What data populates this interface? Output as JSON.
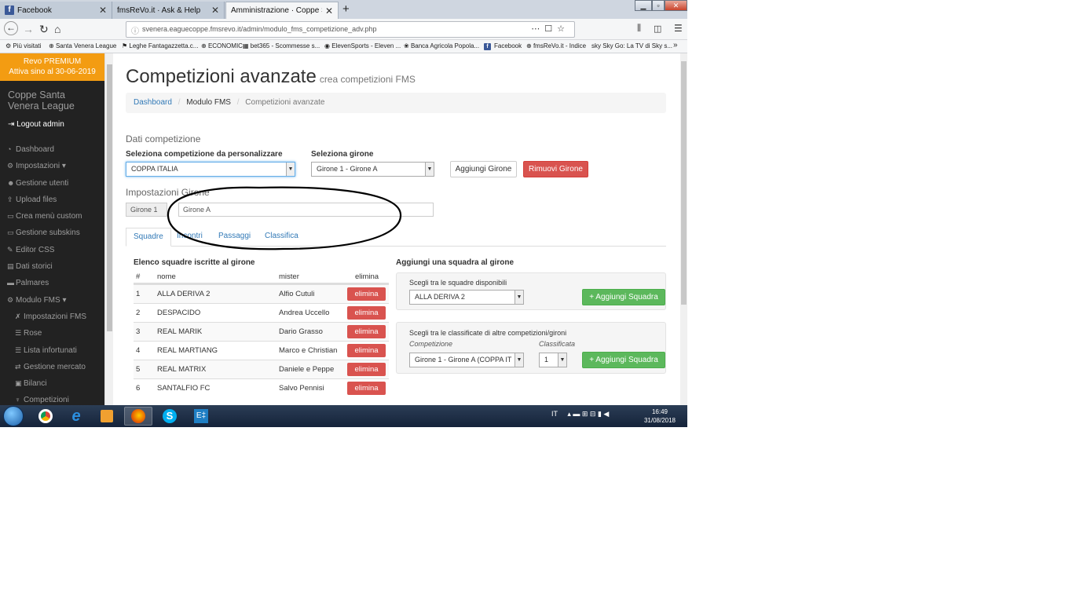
{
  "browser": {
    "tabs": [
      {
        "label": "Facebook",
        "active": false
      },
      {
        "label": "fmsReVo.it · Ask & Help",
        "active": false
      },
      {
        "label": "Amministrazione · Coppe Santa Ve",
        "active": true
      }
    ],
    "new_tab": "+",
    "url": "svenera.eaguecoppe.fmsrevo.it/admin/modulo_fms_competizione_adv.php",
    "bookmarks": [
      "Più visitati",
      "Santa Venera League",
      "Leghe Fantagazzetta.c...",
      "ECONOMIC",
      "bet365 - Scommesse s...",
      "ElevenSports - Eleven ...",
      "Banca Agricola Popola...",
      "Facebook",
      "fmsReVo.it - Indice",
      "Sky Go: La TV di Sky s..."
    ]
  },
  "sidebar": {
    "premium_line1": "Revo PREMIUM",
    "premium_line2": "Attiva sino al 30-06-2019",
    "brand": "Coppe Santa Venera League",
    "logout": "Logout admin",
    "items": [
      {
        "label": "Dashboard",
        "icon": "dashboard-icon",
        "glyph": "◔",
        "sub": false
      },
      {
        "label": "Impostazioni ▾",
        "icon": "gear-icon",
        "glyph": "⚙",
        "sub": false
      },
      {
        "label": "Gestione utenti",
        "icon": "users-icon",
        "glyph": "☻",
        "sub": false
      },
      {
        "label": "Upload files",
        "icon": "upload-icon",
        "glyph": "⇪",
        "sub": false
      },
      {
        "label": "Crea menù custom",
        "icon": "monitor-icon",
        "glyph": "▭",
        "sub": false
      },
      {
        "label": "Gestione subskins",
        "icon": "monitor-icon",
        "glyph": "▭",
        "sub": false
      },
      {
        "label": "Editor CSS",
        "icon": "edit-icon",
        "glyph": "✎",
        "sub": false
      },
      {
        "label": "Dati storici",
        "icon": "file-icon",
        "glyph": "▤",
        "sub": false
      },
      {
        "label": "Palmares",
        "icon": "folder-icon",
        "glyph": "▬",
        "sub": false
      },
      {
        "label": "Modulo FMS ▾",
        "icon": "gear-icon",
        "glyph": "⚙",
        "sub": false
      },
      {
        "label": "Impostazioni FMS",
        "icon": "wrench-icon",
        "glyph": "✗",
        "sub": true
      },
      {
        "label": "Rose",
        "icon": "list-icon",
        "glyph": "☰",
        "sub": true
      },
      {
        "label": "Lista infortunati",
        "icon": "list-icon",
        "glyph": "☰",
        "sub": true
      },
      {
        "label": "Gestione mercato",
        "icon": "exchange-icon",
        "glyph": "⇄",
        "sub": true
      },
      {
        "label": "Bilanci",
        "icon": "money-icon",
        "glyph": "▣",
        "sub": true
      },
      {
        "label": "Competizioni",
        "icon": "trophy-icon",
        "glyph": "♆",
        "sub": true
      }
    ]
  },
  "page": {
    "title": "Competizioni avanzate",
    "subtitle": "crea competizioni FMS",
    "breadcrumb": {
      "home": "Dashboard",
      "section": "Modulo FMS",
      "current": "Competizioni avanzate",
      "sep": "/"
    },
    "dati_title": "Dati competizione",
    "comp_label": "Seleziona competizione da personalizzare",
    "comp_value": "COPPA ITALIA",
    "girone_label": "Seleziona girone",
    "girone_value": "Girone 1 - Girone A",
    "add_girone": "Aggiungi Girone",
    "remove_girone": "Rimuovi Girone",
    "imp_title": "Impostazioni Girone",
    "girone_addon": "Girone 1",
    "girone_name": "Girone A",
    "tabs": [
      "Squadre",
      "Incontri",
      "Passaggi",
      "Classifica"
    ],
    "table": {
      "title": "Elenco squadre iscritte al girone",
      "headers": [
        "#",
        "nome",
        "mister",
        "elimina"
      ],
      "rows": [
        {
          "n": "1",
          "nome": "ALLA DERIVA 2",
          "mister": "Alfio Cutuli",
          "action": "elimina"
        },
        {
          "n": "2",
          "nome": "DESPACIDO",
          "mister": "Andrea Uccello",
          "action": "elimina"
        },
        {
          "n": "3",
          "nome": "REAL MARIK",
          "mister": "Dario Grasso",
          "action": "elimina"
        },
        {
          "n": "4",
          "nome": "REAL MARTIANG",
          "mister": "Marco e Christian",
          "action": "elimina"
        },
        {
          "n": "5",
          "nome": "REAL MATRIX",
          "mister": "Daniele e Peppe",
          "action": "elimina"
        },
        {
          "n": "6",
          "nome": "SANTALFIO FC",
          "mister": "Salvo Pennisi",
          "action": "elimina"
        }
      ]
    },
    "add_panel": {
      "title": "Aggiungi una squadra al girone",
      "choose_label": "Scegli tra le squadre disponibili",
      "choose_value": "ALLA DERIVA 2",
      "add_btn": "+ Aggiungi Squadra",
      "classif_label": "Scegli tra le classificate di altre competizioni/gironi",
      "comp_label": "Competizione",
      "comp_value": "Girone 1 - Girone A (COPPA IT",
      "class_label": "Classificata",
      "class_value": "1",
      "add_btn2": "+ Aggiungi Squadra"
    }
  },
  "taskbar": {
    "lang": "IT",
    "time": "16:49",
    "date": "31/08/2018"
  },
  "colors": {
    "danger": "#d9534f",
    "success": "#5cb85c",
    "premium": "#f39c12",
    "sidebar": "#222222",
    "link": "#337ab7"
  }
}
